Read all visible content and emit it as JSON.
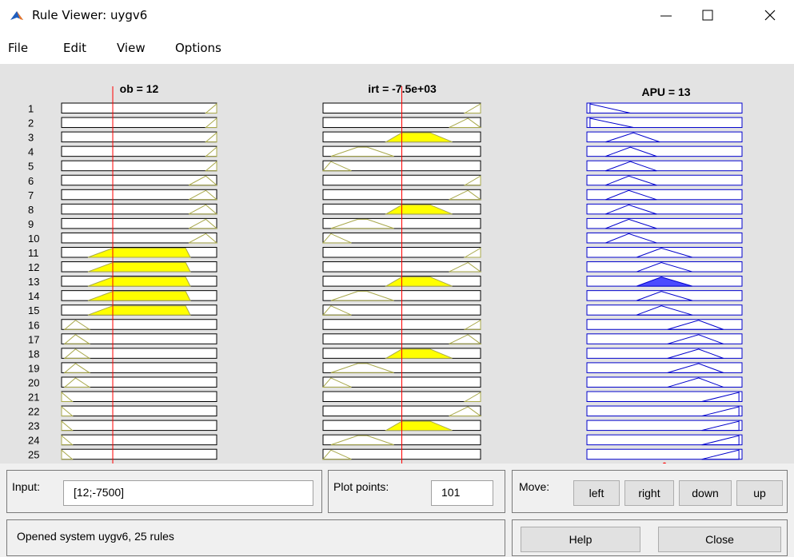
{
  "window": {
    "title": "Rule Viewer: uygv6",
    "minimize_icon": "minimize-icon",
    "maximize_icon": "maximize-icon",
    "close_icon": "close-icon"
  },
  "menu": [
    "File",
    "Edit",
    "View",
    "Options"
  ],
  "columns": [
    {
      "title": "ob = 12",
      "kind": "input",
      "indicator_fraction": 0.33
    },
    {
      "title": "irt = -7.5e+03",
      "kind": "input",
      "indicator_fraction": 0.5
    },
    {
      "title": "APU = 13",
      "kind": "output"
    }
  ],
  "rows": [
    "1",
    "2",
    "3",
    "4",
    "5",
    "6",
    "7",
    "8",
    "9",
    "10",
    "11",
    "12",
    "13",
    "14",
    "15",
    "16",
    "17",
    "18",
    "19",
    "20",
    "21",
    "22",
    "23",
    "24",
    "25"
  ],
  "colors": {
    "background": "#e3e3e3",
    "input_fill": "#ffff00",
    "input_line": "#a8a84a",
    "output_fill": "#4b4bff",
    "output_line": "#0000cc",
    "indicator": "#ff0000"
  },
  "controls": {
    "input_label": "Input:",
    "input_value": "[12;-7500]",
    "plot_points_label": "Plot points:",
    "plot_points_value": "101",
    "move_label": "Move:",
    "move_buttons": [
      "left",
      "right",
      "down",
      "up"
    ],
    "status": "Opened system uygv6, 25 rules",
    "help_label": "Help",
    "close_label": "Close"
  }
}
